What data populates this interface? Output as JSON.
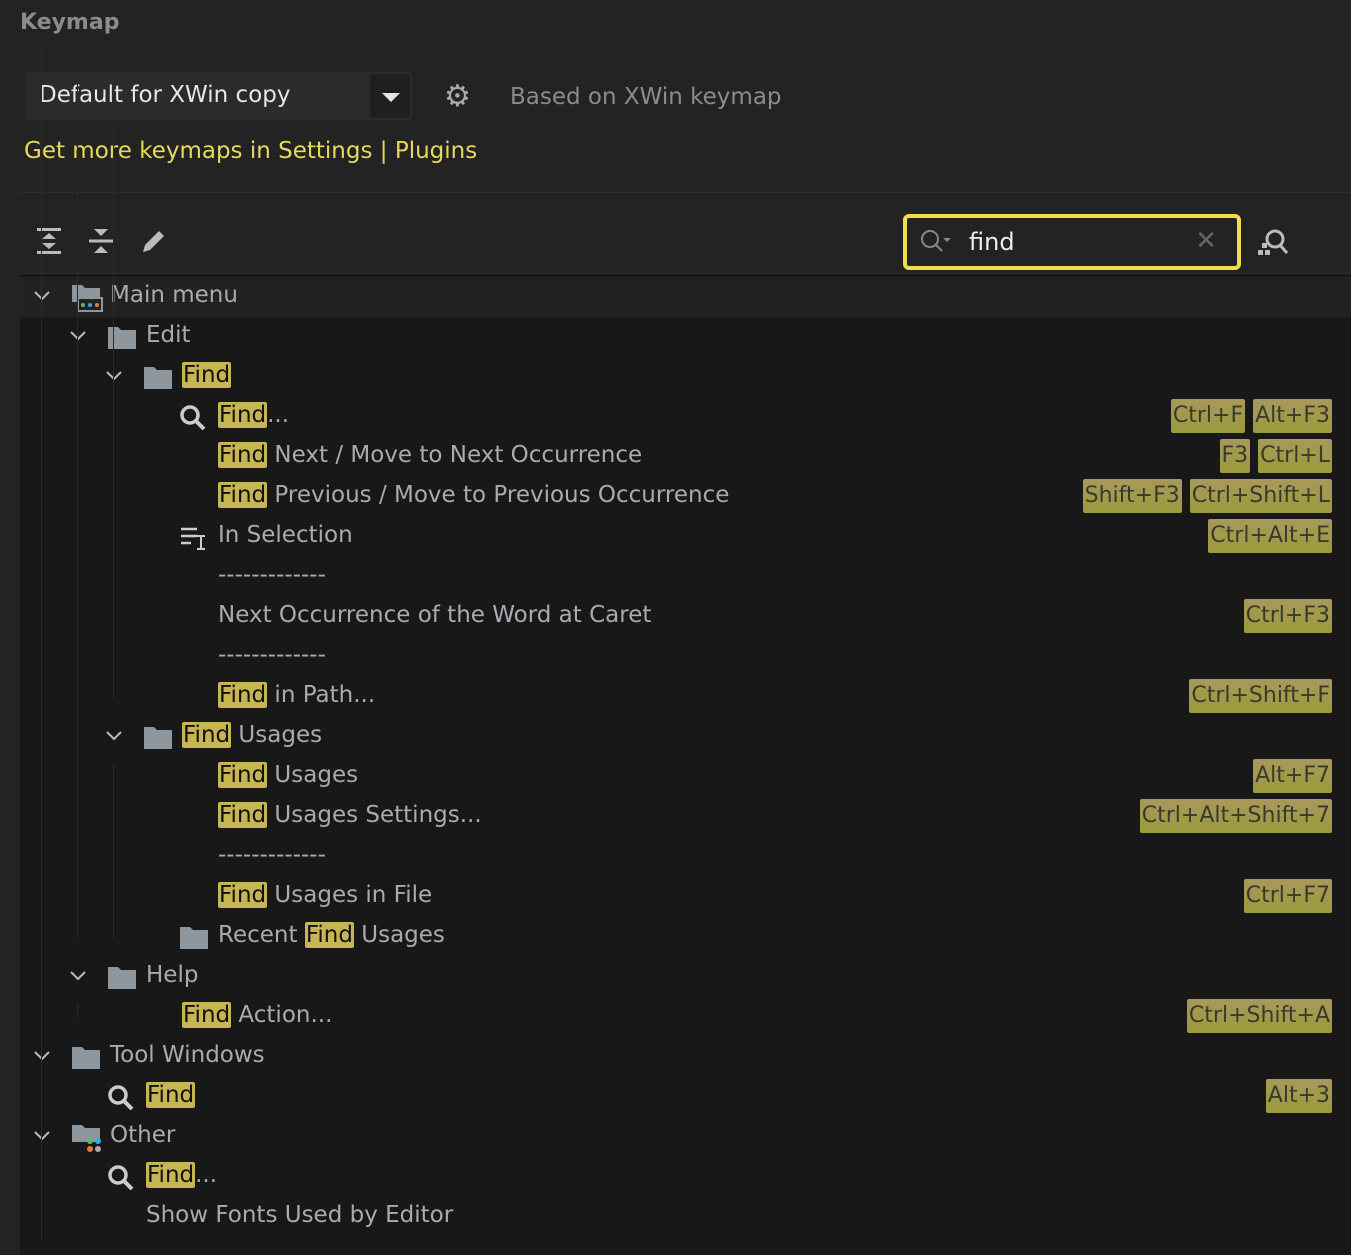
{
  "header": {
    "title": "Keymap",
    "keymap_selected": "Default for XWin copy",
    "based_on": "Based on XWin keymap",
    "link": "Get more keymaps in Settings | Plugins"
  },
  "toolbar": {
    "icons": [
      "expand-all-icon",
      "collapse-all-icon",
      "edit-icon"
    ]
  },
  "search": {
    "value": "find",
    "clear_icon": "close-icon",
    "find_by_shortcut_icon": "find-shortcut-icon"
  },
  "colors": {
    "accent": "#f1dd4a",
    "highlight": "#c7b553",
    "shortcut_badge": "#a7995c",
    "link": "#e8d95a"
  },
  "tree": [
    {
      "level": 0,
      "folder": true,
      "icon": "main-menu-icon",
      "segments": [
        {
          "t": "Main menu"
        }
      ],
      "keys": []
    },
    {
      "level": 1,
      "folder": true,
      "icon": "folder-icon",
      "segments": [
        {
          "t": "Edit"
        }
      ],
      "keys": []
    },
    {
      "level": 2,
      "folder": true,
      "icon": "folder-icon",
      "segments": [
        {
          "t": "Find",
          "hl": true
        }
      ],
      "keys": []
    },
    {
      "level": 3,
      "icon": "search-icon",
      "segments": [
        {
          "t": "Find",
          "hl": true
        },
        {
          "t": "..."
        }
      ],
      "keys": [
        "Ctrl+F",
        "Alt+F3"
      ]
    },
    {
      "level": 3,
      "segments": [
        {
          "t": "Find",
          "hl": true
        },
        {
          "t": " Next / Move to Next Occurrence"
        }
      ],
      "keys": [
        "F3",
        "Ctrl+L"
      ]
    },
    {
      "level": 3,
      "segments": [
        {
          "t": "Find",
          "hl": true
        },
        {
          "t": " Previous / Move to Previous Occurrence"
        }
      ],
      "keys": [
        "Shift+F3",
        "Ctrl+Shift+L"
      ]
    },
    {
      "level": 3,
      "icon": "in-selection-icon",
      "segments": [
        {
          "t": "In Selection"
        }
      ],
      "keys": [
        "Ctrl+Alt+E"
      ]
    },
    {
      "level": 3,
      "segments": [
        {
          "t": "-------------"
        }
      ],
      "keys": []
    },
    {
      "level": 3,
      "segments": [
        {
          "t": "Next Occurrence of the Word at Caret"
        }
      ],
      "keys": [
        "Ctrl+F3"
      ]
    },
    {
      "level": 3,
      "segments": [
        {
          "t": "-------------"
        }
      ],
      "keys": []
    },
    {
      "level": 3,
      "segments": [
        {
          "t": "Find",
          "hl": true
        },
        {
          "t": " in Path..."
        }
      ],
      "keys": [
        "Ctrl+Shift+F"
      ]
    },
    {
      "level": 2,
      "folder": true,
      "icon": "folder-icon",
      "segments": [
        {
          "t": "Find",
          "hl": true
        },
        {
          "t": " Usages"
        }
      ],
      "keys": []
    },
    {
      "level": 3,
      "segments": [
        {
          "t": "Find",
          "hl": true
        },
        {
          "t": " Usages"
        }
      ],
      "keys": [
        "Alt+F7"
      ]
    },
    {
      "level": 3,
      "segments": [
        {
          "t": "Find",
          "hl": true
        },
        {
          "t": " Usages Settings..."
        }
      ],
      "keys": [
        "Ctrl+Alt+Shift+7"
      ]
    },
    {
      "level": 3,
      "segments": [
        {
          "t": "-------------"
        }
      ],
      "keys": []
    },
    {
      "level": 3,
      "segments": [
        {
          "t": "Find",
          "hl": true
        },
        {
          "t": " Usages in File"
        }
      ],
      "keys": [
        "Ctrl+F7"
      ]
    },
    {
      "level": 3,
      "icon": "folder-icon",
      "segments": [
        {
          "t": "Recent "
        },
        {
          "t": "Find",
          "hl": true
        },
        {
          "t": " Usages"
        }
      ],
      "keys": []
    },
    {
      "level": 1,
      "folder": true,
      "icon": "folder-icon",
      "segments": [
        {
          "t": "Help"
        }
      ],
      "keys": []
    },
    {
      "level": 2,
      "segments": [
        {
          "t": "Find",
          "hl": true
        },
        {
          "t": " Action..."
        }
      ],
      "keys": [
        "Ctrl+Shift+A"
      ]
    },
    {
      "level": 0,
      "folder": true,
      "icon": "folder-icon",
      "segments": [
        {
          "t": "Tool Windows"
        }
      ],
      "keys": []
    },
    {
      "level": 1,
      "icon": "search-icon",
      "segments": [
        {
          "t": "Find",
          "hl": true
        }
      ],
      "keys": [
        "Alt+3"
      ]
    },
    {
      "level": 0,
      "folder": true,
      "icon": "other-icon",
      "segments": [
        {
          "t": "Other"
        }
      ],
      "keys": []
    },
    {
      "level": 1,
      "icon": "search-icon",
      "segments": [
        {
          "t": "Find",
          "hl": true
        },
        {
          "t": "..."
        }
      ],
      "keys": []
    },
    {
      "level": 1,
      "segments": [
        {
          "t": "Show Fonts Used by Editor"
        }
      ],
      "keys": []
    }
  ]
}
